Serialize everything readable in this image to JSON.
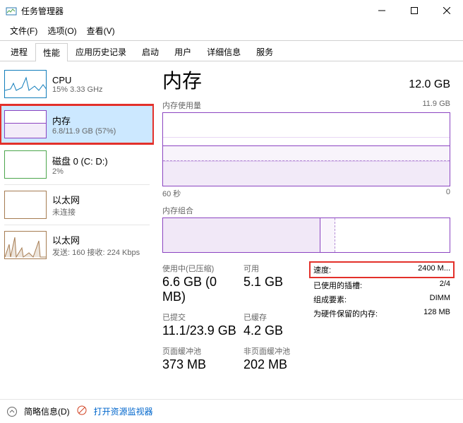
{
  "window": {
    "title": "任务管理器"
  },
  "menu": {
    "file": "文件(F)",
    "options": "选项(O)",
    "view": "查看(V)"
  },
  "tabs": [
    "进程",
    "性能",
    "应用历史记录",
    "启动",
    "用户",
    "详细信息",
    "服务"
  ],
  "active_tab": 1,
  "sidebar": [
    {
      "title": "CPU",
      "sub": "15% 3.33 GHz",
      "thumb": "cpu"
    },
    {
      "title": "内存",
      "sub": "6.8/11.9 GB (57%)",
      "thumb": "mem",
      "selected": true,
      "boxed": true
    },
    {
      "title": "磁盘 0 (C: D:)",
      "sub": "2%",
      "thumb": "disk"
    },
    {
      "title": "以太网",
      "sub": "未连接",
      "thumb": "eth1"
    },
    {
      "title": "以太网",
      "sub": "发送: 160 接收: 224 Kbps",
      "thumb": "eth2"
    }
  ],
  "main": {
    "title": "内存",
    "capacity": "12.0 GB",
    "usage_label": "内存使用量",
    "usage_max": "11.9 GB",
    "axis_left": "60 秒",
    "axis_right": "0",
    "comp_label": "内存组合",
    "stats_left": [
      {
        "label": "使用中(已压缩)",
        "value": "6.6 GB (0 MB)"
      },
      {
        "label": "可用",
        "value": "5.1 GB"
      },
      {
        "label": "已提交",
        "value": "11.1/23.9 GB"
      },
      {
        "label": "已缓存",
        "value": "4.2 GB"
      },
      {
        "label": "页面缓冲池",
        "value": "373 MB"
      },
      {
        "label": "非页面缓冲池",
        "value": "202 MB"
      }
    ],
    "stats_right": [
      {
        "label": "速度:",
        "value": "2400 M...",
        "boxed": true
      },
      {
        "label": "已使用的插槽:",
        "value": "2/4"
      },
      {
        "label": "组成要素:",
        "value": "DIMM"
      },
      {
        "label": "为硬件保留的内存:",
        "value": "128 MB"
      }
    ]
  },
  "footer": {
    "brief": "简略信息(D)",
    "monitor": "打开资源监视器"
  }
}
